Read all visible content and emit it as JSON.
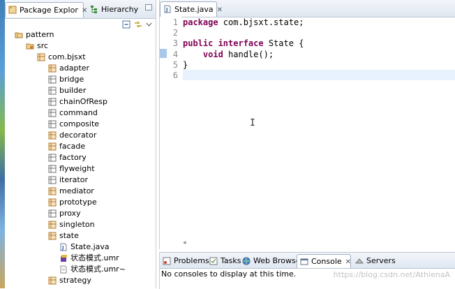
{
  "explorer": {
    "tabs": [
      {
        "label": "Package Explor",
        "icon": "package-explorer-icon"
      },
      {
        "label": "Hierarchy",
        "icon": "hierarchy-icon"
      }
    ],
    "tree": [
      {
        "label": "pattern",
        "icon": "project-icon",
        "level": 0
      },
      {
        "label": "src",
        "icon": "source-folder-icon",
        "level": 1
      },
      {
        "label": "com.bjsxt",
        "icon": "package-icon",
        "level": 2
      },
      {
        "label": "adapter",
        "icon": "package-icon",
        "level": 3
      },
      {
        "label": "bridge",
        "icon": "package-icon",
        "level": 3
      },
      {
        "label": "builder",
        "icon": "package-icon",
        "level": 3
      },
      {
        "label": "chainOfResp",
        "icon": "package-icon",
        "level": 3
      },
      {
        "label": "command",
        "icon": "package-icon",
        "level": 3
      },
      {
        "label": "composite",
        "icon": "package-icon",
        "level": 3
      },
      {
        "label": "decorator",
        "icon": "package-icon",
        "level": 3
      },
      {
        "label": "facade",
        "icon": "package-icon",
        "level": 3
      },
      {
        "label": "factory",
        "icon": "package-icon",
        "level": 3
      },
      {
        "label": "flyweight",
        "icon": "package-icon",
        "level": 3
      },
      {
        "label": "iterator",
        "icon": "package-icon",
        "level": 3
      },
      {
        "label": "mediator",
        "icon": "package-icon",
        "level": 3
      },
      {
        "label": "prototype",
        "icon": "package-icon",
        "level": 3
      },
      {
        "label": "proxy",
        "icon": "package-icon",
        "level": 3
      },
      {
        "label": "singleton",
        "icon": "package-icon",
        "level": 3
      },
      {
        "label": "state",
        "icon": "package-icon",
        "level": 3
      },
      {
        "label": "State.java",
        "icon": "java-file-icon",
        "level": 4
      },
      {
        "label": "状态模式.umr",
        "icon": "uml-file-icon",
        "level": 4
      },
      {
        "label": "状态模式.umr~",
        "icon": "file-icon",
        "level": 4
      },
      {
        "label": "strategy",
        "icon": "package-icon",
        "level": 3
      }
    ]
  },
  "editor": {
    "tab_label": "State.java",
    "line_numbers": [
      "1",
      "2",
      "3",
      "4",
      "5",
      "6"
    ],
    "lines": [
      {
        "kw": "package",
        "rest": " com.bjsxt.state;"
      },
      {
        "kw": "",
        "rest": ""
      },
      {
        "kw": "public interface",
        "rest": " State {"
      },
      {
        "kw": "    void",
        "rest": " handle();"
      },
      {
        "kw": "",
        "rest": "}"
      },
      {
        "kw": "",
        "rest": ""
      }
    ]
  },
  "bottom": {
    "tabs": [
      {
        "label": "Problems",
        "icon": "problems-icon"
      },
      {
        "label": "Tasks",
        "icon": "tasks-icon"
      },
      {
        "label": "Web Browser",
        "icon": "web-browser-icon"
      },
      {
        "label": "Console",
        "icon": "console-icon"
      },
      {
        "label": "Servers",
        "icon": "servers-icon"
      }
    ],
    "message": "No consoles to display at this time."
  },
  "watermark": "https://blog.csdn.net/AthlenaA"
}
